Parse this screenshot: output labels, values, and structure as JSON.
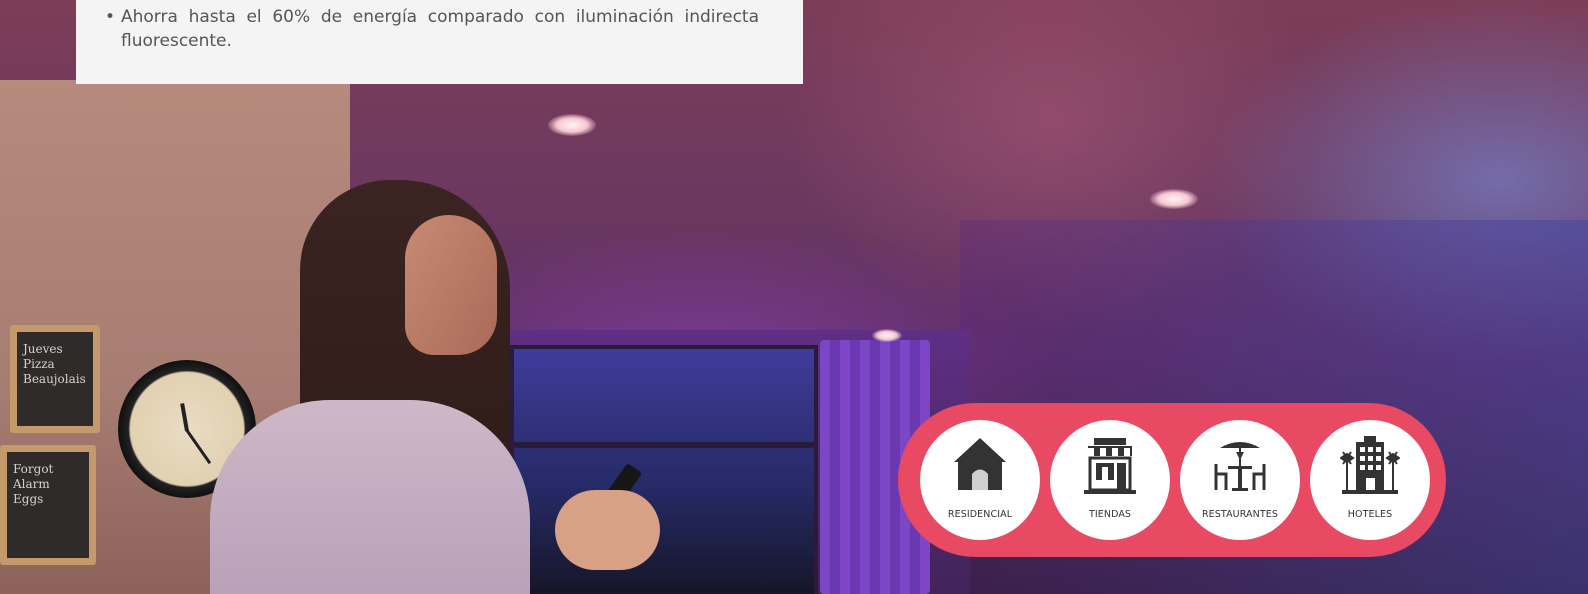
{
  "info_box": {
    "bullets": [
      "Ahorra hasta el 60% de energía comparado con iluminación indirecta fluorescente."
    ]
  },
  "background_photo": {
    "chalkboard_1_text": "Jueves\nPizza\nBeaujolais",
    "chalkboard_2_text": "Forgot\nAlarm\nEggs"
  },
  "categories": [
    {
      "label": "RESIDENCIAL",
      "icon": "house-icon"
    },
    {
      "label": "TIENDAS",
      "icon": "storefront-icon"
    },
    {
      "label": "RESTAURANTES",
      "icon": "restaurant-table-icon"
    },
    {
      "label": "HOTELES",
      "icon": "hotel-building-icon"
    }
  ],
  "colors": {
    "category_bar": "#e74a62",
    "info_box_bg": "#f4f4f4",
    "text": "#555555",
    "icon": "#333333"
  }
}
